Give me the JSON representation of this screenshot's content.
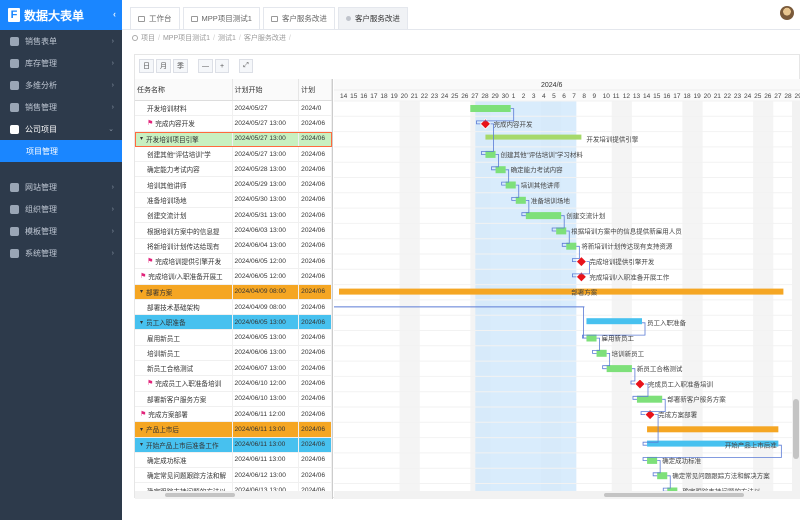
{
  "app": {
    "title": "数据大表单",
    "logo_letter": "F",
    "collapse_icon": "‹"
  },
  "sidebar": {
    "items": [
      {
        "label": "销售表单",
        "icon": "cart-icon",
        "expanded": false
      },
      {
        "label": "库存管理",
        "icon": "box-icon",
        "expanded": false
      },
      {
        "label": "多维分析",
        "icon": "analysis-icon",
        "expanded": false
      },
      {
        "label": "销售管理",
        "icon": "chart-icon",
        "expanded": false
      },
      {
        "label": "公司项目",
        "icon": "briefcase-icon",
        "expanded": true
      },
      {
        "label": "网站管理",
        "icon": "globe-icon",
        "expanded": false
      },
      {
        "label": "组织管理",
        "icon": "org-icon",
        "expanded": false
      },
      {
        "label": "模板管理",
        "icon": "template-icon",
        "expanded": false
      },
      {
        "label": "系统管理",
        "icon": "gear-icon",
        "expanded": false
      }
    ],
    "sub_item": "项目管理"
  },
  "tabs": [
    {
      "label": "工作台"
    },
    {
      "label": "MPP项目测试1"
    },
    {
      "label": "客户服务改进"
    },
    {
      "label": "客户服务改进",
      "active": true
    }
  ],
  "breadcrumb": [
    "项目",
    "MPP项目测试1",
    "测试1",
    "客户服务改进"
  ],
  "toolbar": {
    "buttons": [
      "日",
      "月",
      "季",
      "—",
      "+",
      "⤢"
    ]
  },
  "grid": {
    "headers": [
      "任务名称",
      "计划开始",
      "计划"
    ],
    "rows": [
      {
        "name": "开发培训材料",
        "start": "2024/05/27",
        "end": "2024/0",
        "level": 2,
        "style": "plain"
      },
      {
        "name": "完成内容开发",
        "start": "2024/05/27 13:00",
        "end": "2024/06",
        "level": 2,
        "style": "plain",
        "flag": true
      },
      {
        "name": "开发培训项目引擎",
        "start": "2024/05/27 13:00",
        "end": "2024/06",
        "level": 1,
        "style": "sel",
        "toggle": "▾"
      },
      {
        "name": "创建其他“评估培训”学",
        "start": "2024/05/27 13:00",
        "end": "2024/06",
        "level": 2,
        "style": "plain"
      },
      {
        "name": "确定能力考试内容",
        "start": "2024/05/28 13:00",
        "end": "2024/06",
        "level": 2,
        "style": "plain"
      },
      {
        "name": "培训其他讲师",
        "start": "2024/05/29 13:00",
        "end": "2024/06",
        "level": 2,
        "style": "plain"
      },
      {
        "name": "准备培训场地",
        "start": "2024/05/30 13:00",
        "end": "2024/06",
        "level": 2,
        "style": "plain"
      },
      {
        "name": "创建交流计划",
        "start": "2024/05/31 13:00",
        "end": "2024/06",
        "level": 2,
        "style": "plain"
      },
      {
        "name": "根据培训方案中的信息提",
        "start": "2024/06/03 13:00",
        "end": "2024/06",
        "level": 2,
        "style": "plain"
      },
      {
        "name": "将新培训计划传达给现有",
        "start": "2024/06/04 13:00",
        "end": "2024/06",
        "level": 2,
        "style": "plain"
      },
      {
        "name": "完成培训提供引擎开发",
        "start": "2024/06/05 12:00",
        "end": "2024/06",
        "level": 2,
        "style": "plain",
        "flag": true
      },
      {
        "name": "完成培训/入职准备开展工",
        "start": "2024/06/05 12:00",
        "end": "2024/06",
        "level": 1,
        "style": "plain",
        "flag": true
      },
      {
        "name": "部署方案",
        "start": "2024/04/09 08:00",
        "end": "2024/06",
        "level": 1,
        "style": "orange",
        "toggle": "▾"
      },
      {
        "name": "部署技术基础架构",
        "start": "2024/04/09 08:00",
        "end": "2024/06",
        "level": 2,
        "style": "plain"
      },
      {
        "name": "员工入职准备",
        "start": "2024/06/05 13:00",
        "end": "2024/06",
        "level": 1,
        "style": "blue",
        "toggle": "▾"
      },
      {
        "name": "雇用新员工",
        "start": "2024/06/05 13:00",
        "end": "2024/06",
        "level": 2,
        "style": "plain"
      },
      {
        "name": "培训新员工",
        "start": "2024/06/06 13:00",
        "end": "2024/06",
        "level": 2,
        "style": "plain"
      },
      {
        "name": "新员工合格测试",
        "start": "2024/06/07 13:00",
        "end": "2024/06",
        "level": 2,
        "style": "plain"
      },
      {
        "name": "完成员工入职准备培训",
        "start": "2024/06/10 12:00",
        "end": "2024/06",
        "level": 2,
        "style": "plain",
        "flag": true
      },
      {
        "name": "部署新客户服务方案",
        "start": "2024/06/10 13:00",
        "end": "2024/06",
        "level": 2,
        "style": "plain"
      },
      {
        "name": "完成方案部署",
        "start": "2024/06/11 12:00",
        "end": "2024/06",
        "level": 1,
        "style": "plain",
        "flag": true
      },
      {
        "name": "产品上市后",
        "start": "2024/06/11 13:00",
        "end": "2024/06",
        "level": 1,
        "style": "orange",
        "toggle": "▾"
      },
      {
        "name": "开始产品上市后准备工作",
        "start": "2024/06/11 13:00",
        "end": "2024/06",
        "level": 1,
        "style": "blue",
        "toggle": "▾"
      },
      {
        "name": "确定成功标准",
        "start": "2024/06/11 13:00",
        "end": "2024/06",
        "level": 2,
        "style": "plain"
      },
      {
        "name": "确定常见问题跟踪方法和解",
        "start": "2024/06/12 13:00",
        "end": "2024/06",
        "level": 2,
        "style": "plain"
      },
      {
        "name": "确定跟踪支持问题的方法以",
        "start": "2024/06/13 13:00",
        "end": "2024/06",
        "level": 2,
        "style": "plain"
      }
    ]
  },
  "gantt": {
    "month": "2024/6",
    "days": [
      "14",
      "15",
      "16",
      "17",
      "18",
      "19",
      "20",
      "21",
      "22",
      "23",
      "24",
      "25",
      "26",
      "27",
      "28",
      "29",
      "30",
      "1",
      "2",
      "3",
      "4",
      "5",
      "6",
      "7",
      "8",
      "9",
      "10",
      "11",
      "12",
      "13",
      "14",
      "15",
      "16",
      "17",
      "18",
      "19",
      "20",
      "21",
      "22",
      "23",
      "24",
      "25",
      "26",
      "27",
      "28",
      "29"
    ],
    "labels": [
      {
        "row": 1,
        "text": "完成内容开发"
      },
      {
        "row": 2,
        "text": "开发培训提供引擎"
      },
      {
        "row": 3,
        "text": "创建其他“评估培训”学习材料"
      },
      {
        "row": 4,
        "text": "确定能力考试内容"
      },
      {
        "row": 5,
        "text": "培训其他讲师"
      },
      {
        "row": 6,
        "text": "准备培训场地"
      },
      {
        "row": 7,
        "text": "创建交流计划"
      },
      {
        "row": 8,
        "text": "根据培训方案中的信息提供新雇用人员"
      },
      {
        "row": 9,
        "text": "将新培训计划传达现有支持资源"
      },
      {
        "row": 10,
        "text": "完成培训提供引擎开发"
      },
      {
        "row": 11,
        "text": "完成培训/入职准备开展工作"
      },
      {
        "row": 12,
        "text": "部署方案"
      },
      {
        "row": 14,
        "text": "员工入职准备"
      },
      {
        "row": 15,
        "text": "雇用新员工"
      },
      {
        "row": 16,
        "text": "培训新员工"
      },
      {
        "row": 17,
        "text": "新员工合格测试"
      },
      {
        "row": 18,
        "text": "完成员工入职准备培训"
      },
      {
        "row": 19,
        "text": "部署新客户服务方案"
      },
      {
        "row": 20,
        "text": "完成方案部署"
      },
      {
        "row": 22,
        "text": "开始产品上市后准"
      },
      {
        "row": 23,
        "text": "确定成功标准"
      },
      {
        "row": 24,
        "text": "确定常见问题跟踪方法和解决方案"
      },
      {
        "row": 25,
        "text": "确定跟踪支持问题的方法以"
      }
    ]
  }
}
